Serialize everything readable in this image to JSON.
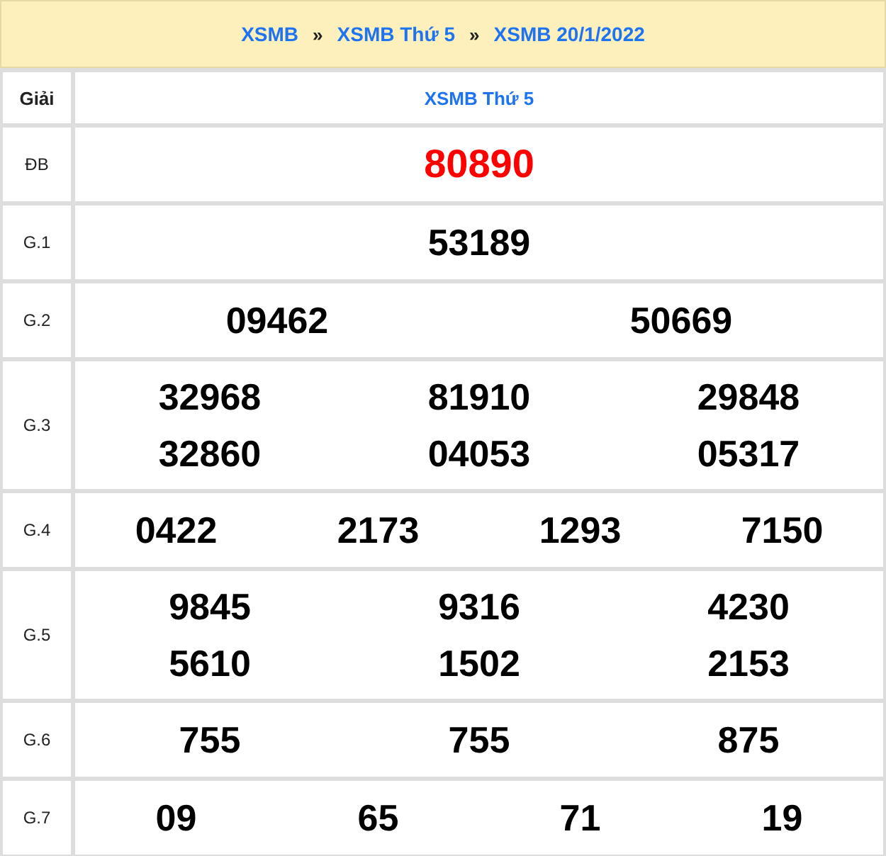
{
  "breadcrumb": {
    "separator": "»",
    "items": [
      "XSMB",
      "XSMB Thứ 5",
      "XSMB 20/1/2022"
    ]
  },
  "table": {
    "header_label": "Giải",
    "header_title": "XSMB Thứ 5",
    "rows": [
      {
        "label": "ĐB",
        "kind": "special",
        "lines": [
          [
            "80890"
          ]
        ]
      },
      {
        "label": "G.1",
        "kind": "regular",
        "lines": [
          [
            "53189"
          ]
        ]
      },
      {
        "label": "G.2",
        "kind": "regular",
        "lines": [
          [
            "09462",
            "50669"
          ]
        ]
      },
      {
        "label": "G.3",
        "kind": "regular",
        "lines": [
          [
            "32968",
            "81910",
            "29848"
          ],
          [
            "32860",
            "04053",
            "05317"
          ]
        ]
      },
      {
        "label": "G.4",
        "kind": "regular",
        "lines": [
          [
            "0422",
            "2173",
            "1293",
            "7150"
          ]
        ]
      },
      {
        "label": "G.5",
        "kind": "regular",
        "lines": [
          [
            "9845",
            "9316",
            "4230"
          ],
          [
            "5610",
            "1502",
            "2153"
          ]
        ]
      },
      {
        "label": "G.6",
        "kind": "regular",
        "lines": [
          [
            "755",
            "755",
            "875"
          ]
        ]
      },
      {
        "label": "G.7",
        "kind": "regular",
        "lines": [
          [
            "09",
            "65",
            "71",
            "19"
          ]
        ]
      }
    ]
  }
}
